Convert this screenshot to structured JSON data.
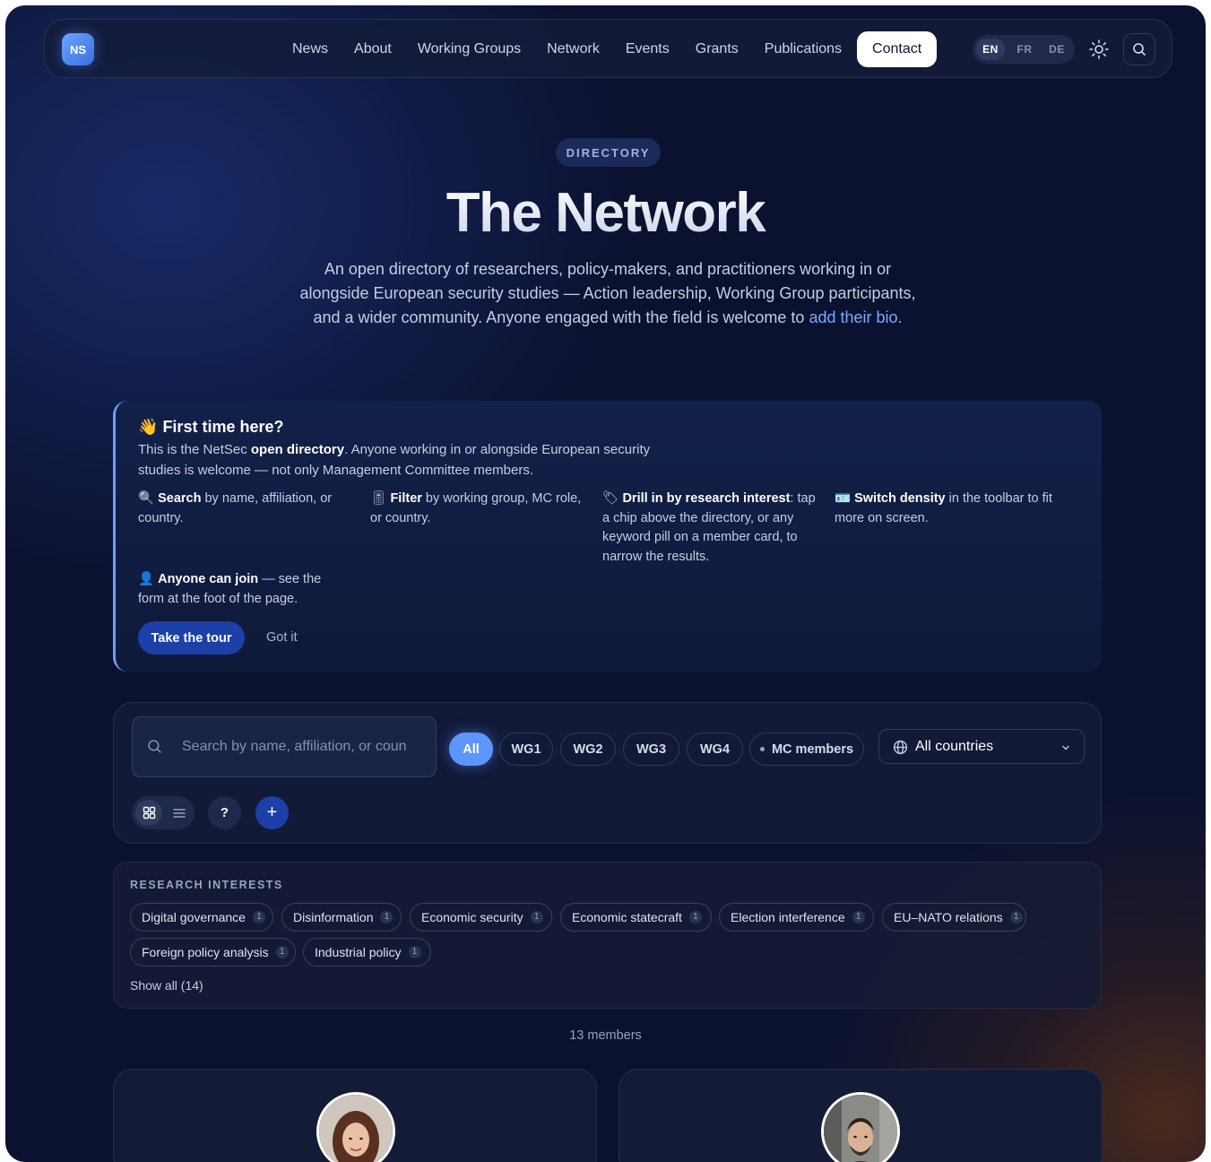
{
  "brand": {
    "logo_text": "NS"
  },
  "nav": {
    "links": [
      "News",
      "About",
      "Working Groups",
      "Network",
      "Events",
      "Grants",
      "Publications"
    ],
    "contact": "Contact",
    "languages": [
      "EN",
      "FR",
      "DE"
    ],
    "active_language": "EN"
  },
  "hero": {
    "badge": "DIRECTORY",
    "title": "The Network",
    "description": "An open directory of researchers, policy-makers, and practitioners working in or alongside European security studies — Action leadership, Working Group participants, and a wider community. Anyone engaged with the field is welcome to ",
    "link_text": "add their bio",
    "description_end": "."
  },
  "callout": {
    "title_emoji": "👋",
    "title": "First time here?",
    "intro_pre": "This is the NetSec ",
    "intro_bold": "open directory",
    "intro_post": ". Anyone working in or alongside European security studies is welcome — not only Management Committee members.",
    "tips": [
      {
        "icon": "🔍",
        "bold": "Search",
        "text": " by name, affiliation, or country."
      },
      {
        "icon": "🎚",
        "bold": "Filter",
        "text": " by working group, MC role, or country."
      },
      {
        "icon": "🏷",
        "bold": "Drill in by research interest",
        "text": ": tap a chip above the directory, or any keyword pill on a member card, to narrow the results."
      },
      {
        "icon": "🪪",
        "bold": "Switch density",
        "text": " in the toolbar to fit more on screen."
      },
      {
        "icon": "👤",
        "bold": "Anyone can join",
        "text": " — see the form at the foot of the page."
      }
    ],
    "tour_button": "Take the tour",
    "dismiss": "Got it"
  },
  "toolbar": {
    "search_placeholder": "Search by name, affiliation, or country",
    "filters": [
      "All",
      "WG1",
      "WG2",
      "WG3",
      "WG4",
      "MC members"
    ],
    "active_filter": "All",
    "country_select": "All countries",
    "help_label": "?",
    "add_label": "+"
  },
  "interests": {
    "title": "RESEARCH INTERESTS",
    "chips": [
      {
        "label": "Digital governance",
        "count": "1"
      },
      {
        "label": "Disinformation",
        "count": "1"
      },
      {
        "label": "Economic security",
        "count": "1"
      },
      {
        "label": "Economic statecraft",
        "count": "1"
      },
      {
        "label": "Election interference",
        "count": "1"
      },
      {
        "label": "EU–NATO relations",
        "count": "1"
      },
      {
        "label": "Foreign policy analysis",
        "count": "1"
      },
      {
        "label": "Industrial policy",
        "count": "1"
      }
    ],
    "show_all": "Show all (14)"
  },
  "members": {
    "count_label": "13 members"
  },
  "colors": {
    "accent": "#5c96ff",
    "primary_button": "#1c3fa8",
    "background": "#0b1230"
  },
  "icons": [
    "search-icon",
    "sun-icon",
    "globe-icon",
    "chevron-down-icon",
    "grid-view-icon",
    "list-view-icon"
  ]
}
